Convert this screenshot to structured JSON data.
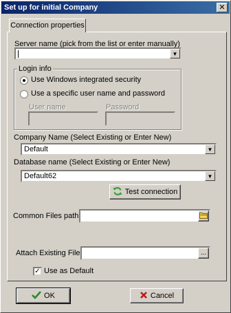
{
  "window": {
    "title": "Set up for initial Company",
    "close_glyph": "✕"
  },
  "tabs": [
    {
      "label": "Connection properties"
    }
  ],
  "server": {
    "label": "Server name (pick from the list or enter manually)",
    "value": ""
  },
  "login": {
    "group_title": "Login info",
    "option_windows": "Use Windows integrated security",
    "option_specific": "Use a specific user name and password",
    "selected": "windows",
    "username_label": "User name",
    "username_value": "",
    "password_label": "Password",
    "password_value": ""
  },
  "company": {
    "label": "Company Name (Select Existing or Enter New)",
    "value": "Default"
  },
  "database": {
    "label": "Database name (Select Existing or Enter New)",
    "value": "Default62"
  },
  "test_button": {
    "label": "Test connection",
    "icon": "refresh-icon"
  },
  "common_files": {
    "label": "Common Files path:",
    "value": "",
    "browse_icon": "folder-icon"
  },
  "attach": {
    "label": "Attach Existing File:",
    "value": "",
    "browse_label": "..."
  },
  "use_default": {
    "label": "Use as Default",
    "checked": true
  },
  "footer": {
    "ok_label": "OK",
    "ok_icon": "checkmark-icon",
    "cancel_label": "Cancel",
    "cancel_icon": "x-icon"
  },
  "colors": {
    "titlebar_start": "#0a246a",
    "titlebar_end": "#3a6ea5",
    "ok_check": "#2a8a2a",
    "cancel_x": "#c01818",
    "refresh_green": "#3aa03a"
  }
}
